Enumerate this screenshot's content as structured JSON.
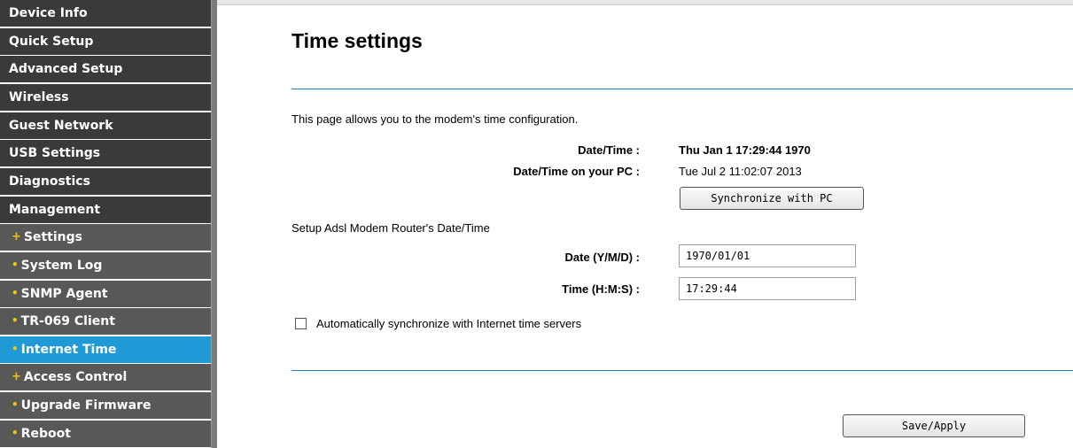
{
  "sidebar": {
    "items": [
      {
        "label": "Device Info",
        "type": "main"
      },
      {
        "label": "Quick Setup",
        "type": "main"
      },
      {
        "label": "Advanced Setup",
        "type": "main"
      },
      {
        "label": "Wireless",
        "type": "main"
      },
      {
        "label": "Guest Network",
        "type": "main"
      },
      {
        "label": "USB Settings",
        "type": "main"
      },
      {
        "label": "Diagnostics",
        "type": "main"
      },
      {
        "label": "Management",
        "type": "main"
      },
      {
        "label": "Settings",
        "type": "sub",
        "bullet": "+"
      },
      {
        "label": "System Log",
        "type": "sub",
        "bullet": "•"
      },
      {
        "label": "SNMP Agent",
        "type": "sub",
        "bullet": "•"
      },
      {
        "label": "TR-069 Client",
        "type": "sub",
        "bullet": "•"
      },
      {
        "label": "Internet Time",
        "type": "sub",
        "bullet": "•",
        "active": true
      },
      {
        "label": "Access Control",
        "type": "sub",
        "bullet": "+"
      },
      {
        "label": "Upgrade Firmware",
        "type": "sub",
        "bullet": "•"
      },
      {
        "label": "Reboot",
        "type": "sub",
        "bullet": "•"
      }
    ]
  },
  "main": {
    "title": "Time settings",
    "description": "This page allows you to the modem's time configuration.",
    "datetime_label": "Date/Time :",
    "datetime_value": "Thu Jan 1 17:29:44 1970",
    "pc_datetime_label": "Date/Time on your PC :",
    "pc_datetime_value": "Tue Jul 2 11:02:07 2013",
    "sync_button": "Synchronize with PC",
    "setup_label": "Setup Adsl Modem Router's Date/Time",
    "date_label": "Date (Y/M/D) :",
    "date_value": "1970/01/01",
    "time_label": "Time (H:M:S) :",
    "time_value": "17:29:44",
    "auto_sync_label": "Automatically synchronize with Internet time servers",
    "auto_sync_checked": false,
    "save_button": "Save/Apply"
  },
  "colors": {
    "nav_main_bg": "#3a3a3a",
    "nav_sub_bg": "#585858",
    "nav_active_bg": "#1f9ad6",
    "bullet": "#f1c40f",
    "rule": "#2a7ab8"
  }
}
